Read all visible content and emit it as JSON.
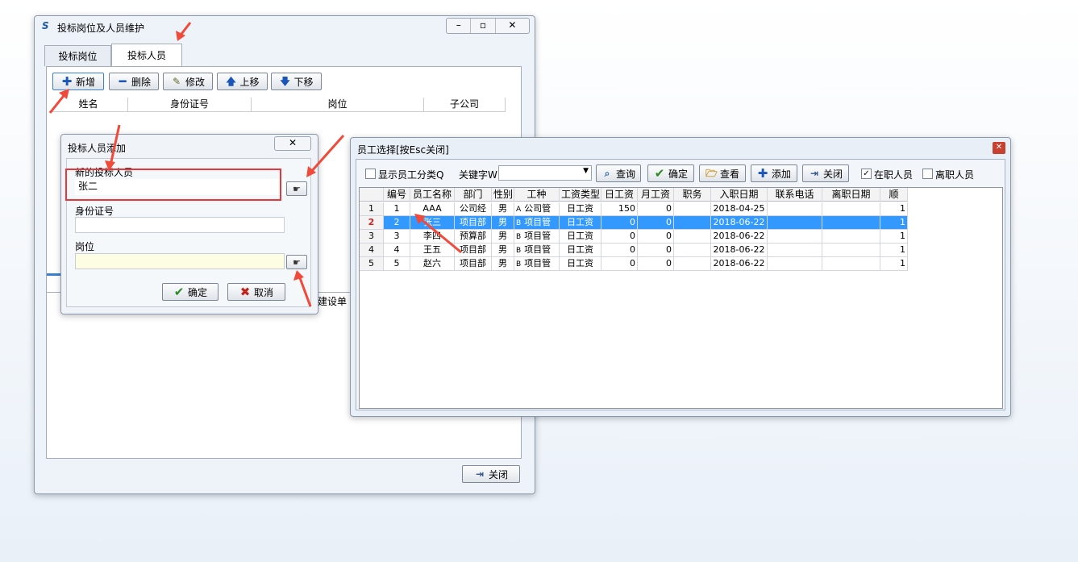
{
  "main_window": {
    "title": "投标岗位及人员维护",
    "tabs": [
      "投标岗位",
      "投标人员"
    ],
    "toolbar": {
      "add": "新增",
      "delete": "删除",
      "edit": "修改",
      "up": "上移",
      "down": "下移"
    },
    "columns": [
      "姓名",
      "身份证号",
      "岗位",
      "子公司"
    ],
    "lower_fragment": "建设单",
    "close": "关闭"
  },
  "add_dialog": {
    "title": "投标人员添加",
    "new_person_label": "新的投标人员",
    "new_person_value": "张二",
    "id_label": "身份证号",
    "id_value": "",
    "post_label": "岗位",
    "post_value": "",
    "ok": "确定",
    "cancel": "取消"
  },
  "employee_window": {
    "title": "员工选择[按Esc关闭]",
    "toolbar": {
      "show_category": "显示员工分类Q",
      "keyword_label": "关键字W",
      "keyword_value": "",
      "query": "查询",
      "confirm": "确定",
      "view": "查看",
      "add": "添加",
      "close": "关闭",
      "on_job": "在职人员",
      "left_job": "离职人员"
    },
    "columns": [
      "编号",
      "员工名称",
      "部门",
      "性别",
      "工种",
      "工资类型",
      "日工资",
      "月工资",
      "职务",
      "入职日期",
      "联系电话",
      "离职日期",
      "顺"
    ],
    "rows": [
      {
        "idx": "1",
        "no": "1",
        "name": "AAA",
        "dept": "公司经",
        "sex": "男",
        "type_code": "A",
        "type": "公司管",
        "wage_type": "日工资",
        "daily": "150",
        "monthly": "0",
        "post": "",
        "date": "2018-04-25",
        "phone": "",
        "leave": "",
        "order": "1"
      },
      {
        "idx": "2",
        "no": "2",
        "name": "张三",
        "dept": "项目部",
        "sex": "男",
        "type_code": "B",
        "type": "项目管",
        "wage_type": "日工资",
        "daily": "0",
        "monthly": "0",
        "post": "",
        "date": "2018-06-22",
        "phone": "",
        "leave": "",
        "order": "1"
      },
      {
        "idx": "3",
        "no": "3",
        "name": "李四",
        "dept": "预算部",
        "sex": "男",
        "type_code": "B",
        "type": "项目管",
        "wage_type": "日工资",
        "daily": "0",
        "monthly": "0",
        "post": "",
        "date": "2018-06-22",
        "phone": "",
        "leave": "",
        "order": "1"
      },
      {
        "idx": "4",
        "no": "4",
        "name": "王五",
        "dept": "项目部",
        "sex": "男",
        "type_code": "B",
        "type": "项目管",
        "wage_type": "日工资",
        "daily": "0",
        "monthly": "0",
        "post": "",
        "date": "2018-06-22",
        "phone": "",
        "leave": "",
        "order": "1"
      },
      {
        "idx": "5",
        "no": "5",
        "name": "赵六",
        "dept": "项目部",
        "sex": "男",
        "type_code": "B",
        "type": "项目管",
        "wage_type": "日工资",
        "daily": "0",
        "monthly": "0",
        "post": "",
        "date": "2018-06-22",
        "phone": "",
        "leave": "",
        "order": "1"
      }
    ],
    "selected_row": 1
  },
  "colors": {
    "annotation": "#f04a3a",
    "selection": "#3399ff",
    "highlight_box": "#e8363b"
  }
}
